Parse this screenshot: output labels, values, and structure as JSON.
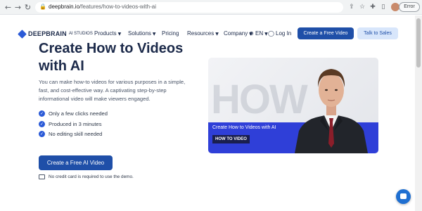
{
  "browser": {
    "url_domain": "deepbrain.io",
    "url_path": "/features/how-to-videos-with-ai",
    "error_label": "Error",
    "icons": [
      "back-icon",
      "forward-icon",
      "reload-icon",
      "lock-icon",
      "share-icon",
      "star-icon",
      "extension-icon",
      "sidebar-icon",
      "profile-icon"
    ]
  },
  "nav": {
    "logo_main": "DEEPBRAIN",
    "logo_sub": "AI STUDIOS",
    "products": "Products",
    "solutions": "Solutions",
    "pricing": "Pricing",
    "resources": "Resources",
    "company": "Company",
    "language": "EN",
    "login": "Log In",
    "cta_free": "Create a Free Video",
    "cta_sales": "Talk to Sales"
  },
  "hero": {
    "headline_line1": "Create How to Videos",
    "headline_line2": "with AI",
    "description": "You can make how-to videos for various purposes in a simple, fast, and cost-effective way. A captivating step-by-step informational video will make viewers engaged.",
    "checks": [
      "Only a few clicks needed",
      "Produced in 3 minutes",
      "No editing skill needed"
    ],
    "cta": "Create a Free AI Video",
    "note": "No credit card is required to use the demo."
  },
  "video": {
    "background_text": "HOW",
    "caption": "Create How to Videos with AI",
    "tag": "HOW TO VIDEO"
  },
  "colors": {
    "brand": "#1f4fa8",
    "accent_light": "#d8e6fb",
    "video_bar": "#2f3fd8",
    "text_dark": "#1c2a4a"
  }
}
